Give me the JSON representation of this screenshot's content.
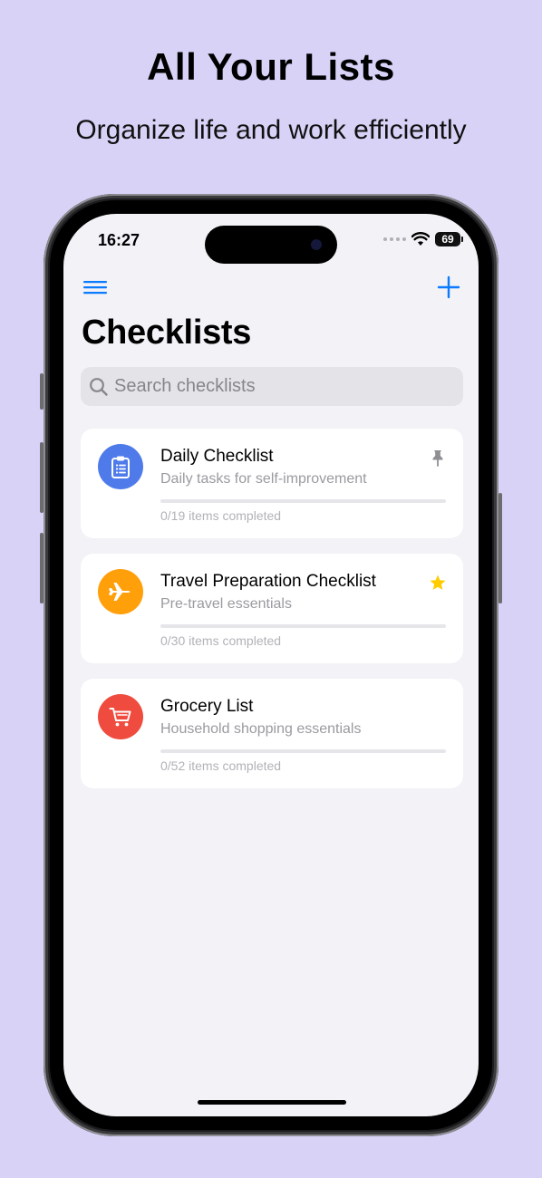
{
  "headline": "All Your Lists",
  "subheadline": "Organize life and work efficiently",
  "status_bar": {
    "time": "16:27",
    "battery": "69"
  },
  "nav": {
    "menu_icon": "hamburger-menu-icon",
    "add_icon": "plus-icon"
  },
  "title": "Checklists",
  "search": {
    "placeholder": "Search checklists",
    "value": ""
  },
  "checklists": [
    {
      "title": "Daily Checklist",
      "subtitle": "Daily tasks for self-improvement",
      "count_text": "0/19 items completed",
      "completed": 0,
      "total": 19,
      "icon": "clipboard-icon",
      "icon_color": "#4f7bea",
      "badge": "pin-icon"
    },
    {
      "title": "Travel Preparation Checklist",
      "subtitle": "Pre-travel essentials",
      "count_text": "0/30 items completed",
      "completed": 0,
      "total": 30,
      "icon": "airplane-icon",
      "icon_color": "#ff9f0a",
      "badge": "star-icon"
    },
    {
      "title": "Grocery List",
      "subtitle": "Household shopping essentials",
      "count_text": "0/52 items completed",
      "completed": 0,
      "total": 52,
      "icon": "cart-icon",
      "icon_color": "#ef4b3e",
      "badge": ""
    }
  ],
  "colors": {
    "background": "#d9d2f7",
    "accent": "#0a7aff",
    "screen": "#f2f2f7",
    "star": "#ffcc00"
  }
}
